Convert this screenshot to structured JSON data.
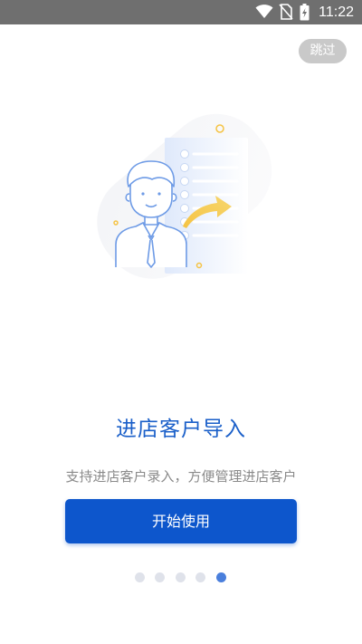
{
  "status_bar": {
    "time": "11:22",
    "icons": [
      "wifi-icon",
      "no-sim-icon",
      "battery-charging-icon"
    ]
  },
  "skip_label": "跳过",
  "illustration": {
    "icon": "customer-import-illustration",
    "accent_color": "#f5c343",
    "line_color": "#6e9be6"
  },
  "title": "进店客户导入",
  "subtitle": "支持进店客户录入，方便管理进店客户",
  "start_button_label": "开始使用",
  "pager": {
    "total": 5,
    "active_index": 4
  },
  "colors": {
    "primary": "#0d56cc",
    "title": "#1a5fc9",
    "subtitle": "#8a8a8a",
    "dot_inactive": "#dfe2ea",
    "dot_active": "#4a7fdc"
  }
}
